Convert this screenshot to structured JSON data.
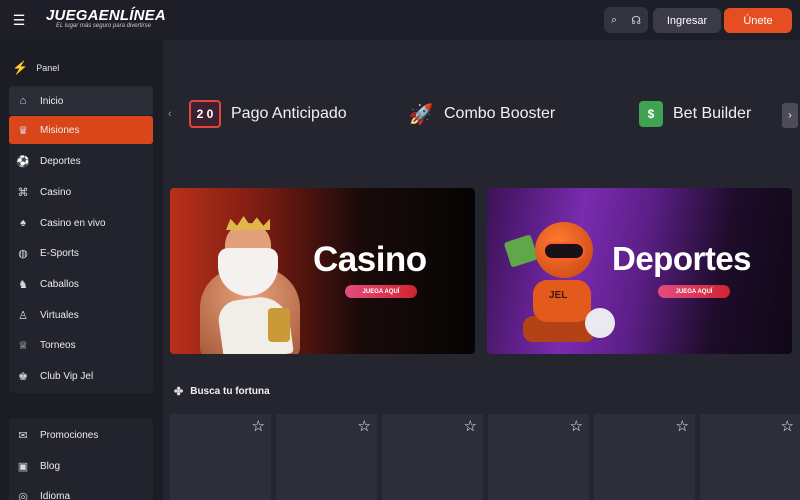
{
  "header": {
    "menu_icon": "hamburger-icon",
    "logo": "JUEGAENLÍNEA",
    "tagline": "EL lugar más seguro para divertirse",
    "login_label": "Ingresar",
    "signup_label": "Únete",
    "accent_color": "#e54e20"
  },
  "sidebar": {
    "panel_label": "Panel",
    "items": [
      {
        "label": "Inicio",
        "icon": "home-icon"
      },
      {
        "label": "Misiones",
        "icon": "crown-icon",
        "active": true
      },
      {
        "label": "Deportes",
        "icon": "soccer-ball-icon"
      },
      {
        "label": "Casino",
        "icon": "casino-building-icon"
      },
      {
        "label": "Casino en vivo",
        "icon": "dealer-icon"
      },
      {
        "label": "E-Sports",
        "icon": "gamepad-icon"
      },
      {
        "label": "Caballos",
        "icon": "horse-icon"
      },
      {
        "label": "Virtuales",
        "icon": "virtual-player-icon"
      },
      {
        "label": "Torneos",
        "icon": "trophy-icon"
      },
      {
        "label": "Club Vip Jel",
        "icon": "vip-crown-icon"
      }
    ],
    "secondary": [
      {
        "label": "Promociones",
        "icon": "gift-icon"
      },
      {
        "label": "Blog",
        "icon": "blog-icon"
      },
      {
        "label": "Idioma",
        "icon": "globe-icon"
      }
    ]
  },
  "promos": [
    {
      "label": "Pago Anticipado",
      "icon": "scoreboard-icon",
      "icon_text": "2 0"
    },
    {
      "label": "Combo Booster",
      "icon": "rocket-icon"
    },
    {
      "label": "Bet Builder",
      "icon": "dollar-box-icon"
    }
  ],
  "banners": [
    {
      "title": "Casino",
      "cta": "JUEGA AQUÍ"
    },
    {
      "title": "Deportes",
      "cta": "JUEGA AQUÍ"
    }
  ],
  "robot_tag": "JEL",
  "section": {
    "title": "Busca tu fortuna",
    "icon": "clover-icon"
  }
}
